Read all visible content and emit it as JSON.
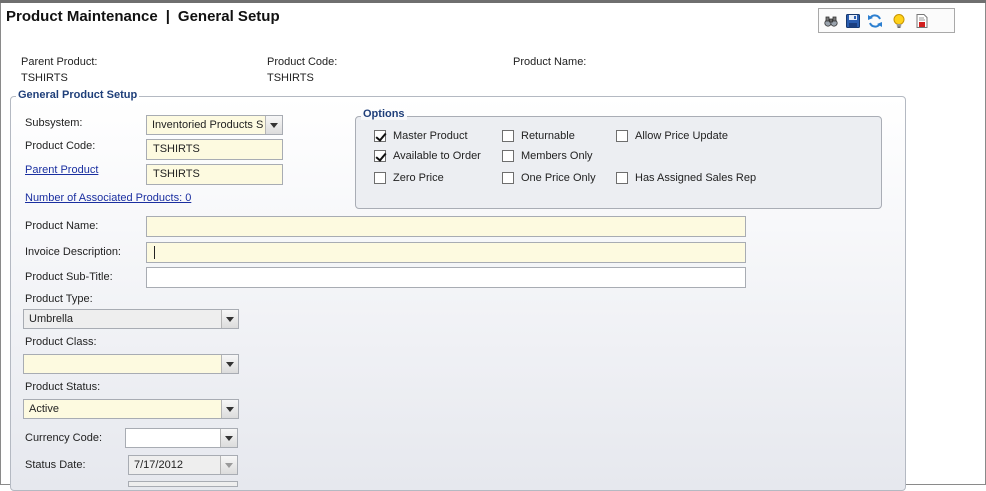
{
  "window": {
    "title_part1": "Product Maintenance",
    "title_sep": "|",
    "title_part2": "General Setup"
  },
  "toolbar": {
    "icons": [
      "search-binoculars-icon",
      "save-icon",
      "refresh-icon",
      "lightbulb-help-icon",
      "report-icon"
    ]
  },
  "header_info": {
    "parent_product_label": "Parent Product:",
    "parent_product_value": "TSHIRTS",
    "product_code_label": "Product Code:",
    "product_code_value": "TSHIRTS",
    "product_name_label": "Product Name:"
  },
  "general_setup": {
    "legend": "General Product Setup",
    "subsystem_label": "Subsystem:",
    "subsystem_value": "Inventoried Products S",
    "product_code_label": "Product Code:",
    "product_code_value": "TSHIRTS",
    "parent_product_link": "Parent Product",
    "parent_product_value": "TSHIRTS",
    "associated_products_link": "Number of Associated Products: 0",
    "product_name_label": "Product Name:",
    "product_name_value": "",
    "invoice_description_label": "Invoice Description:",
    "invoice_description_value": "",
    "product_subtitle_label": "Product Sub-Title:",
    "product_subtitle_value": "",
    "product_type_label": "Product Type:",
    "product_type_value": "Umbrella",
    "product_class_label": "Product Class:",
    "product_class_value": "",
    "product_status_label": "Product Status:",
    "product_status_value": "Active",
    "currency_code_label": "Currency Code:",
    "currency_code_value": "",
    "status_date_label": "Status Date:",
    "status_date_value": "7/17/2012"
  },
  "options": {
    "legend": "Options",
    "items": [
      {
        "label": "Master Product",
        "checked": true
      },
      {
        "label": "Available to Order",
        "checked": true
      },
      {
        "label": "Zero Price",
        "checked": false
      },
      {
        "label": "Returnable",
        "checked": false
      },
      {
        "label": "Members Only",
        "checked": false
      },
      {
        "label": "One Price Only",
        "checked": false
      },
      {
        "label": "Allow Price Update",
        "checked": false
      },
      {
        "label": "Has Assigned Sales Rep",
        "checked": false
      }
    ]
  },
  "colors": {
    "required_field_bg": "#fdfae0",
    "legend_text": "#1f3f7a",
    "link": "#1a2fa0"
  }
}
